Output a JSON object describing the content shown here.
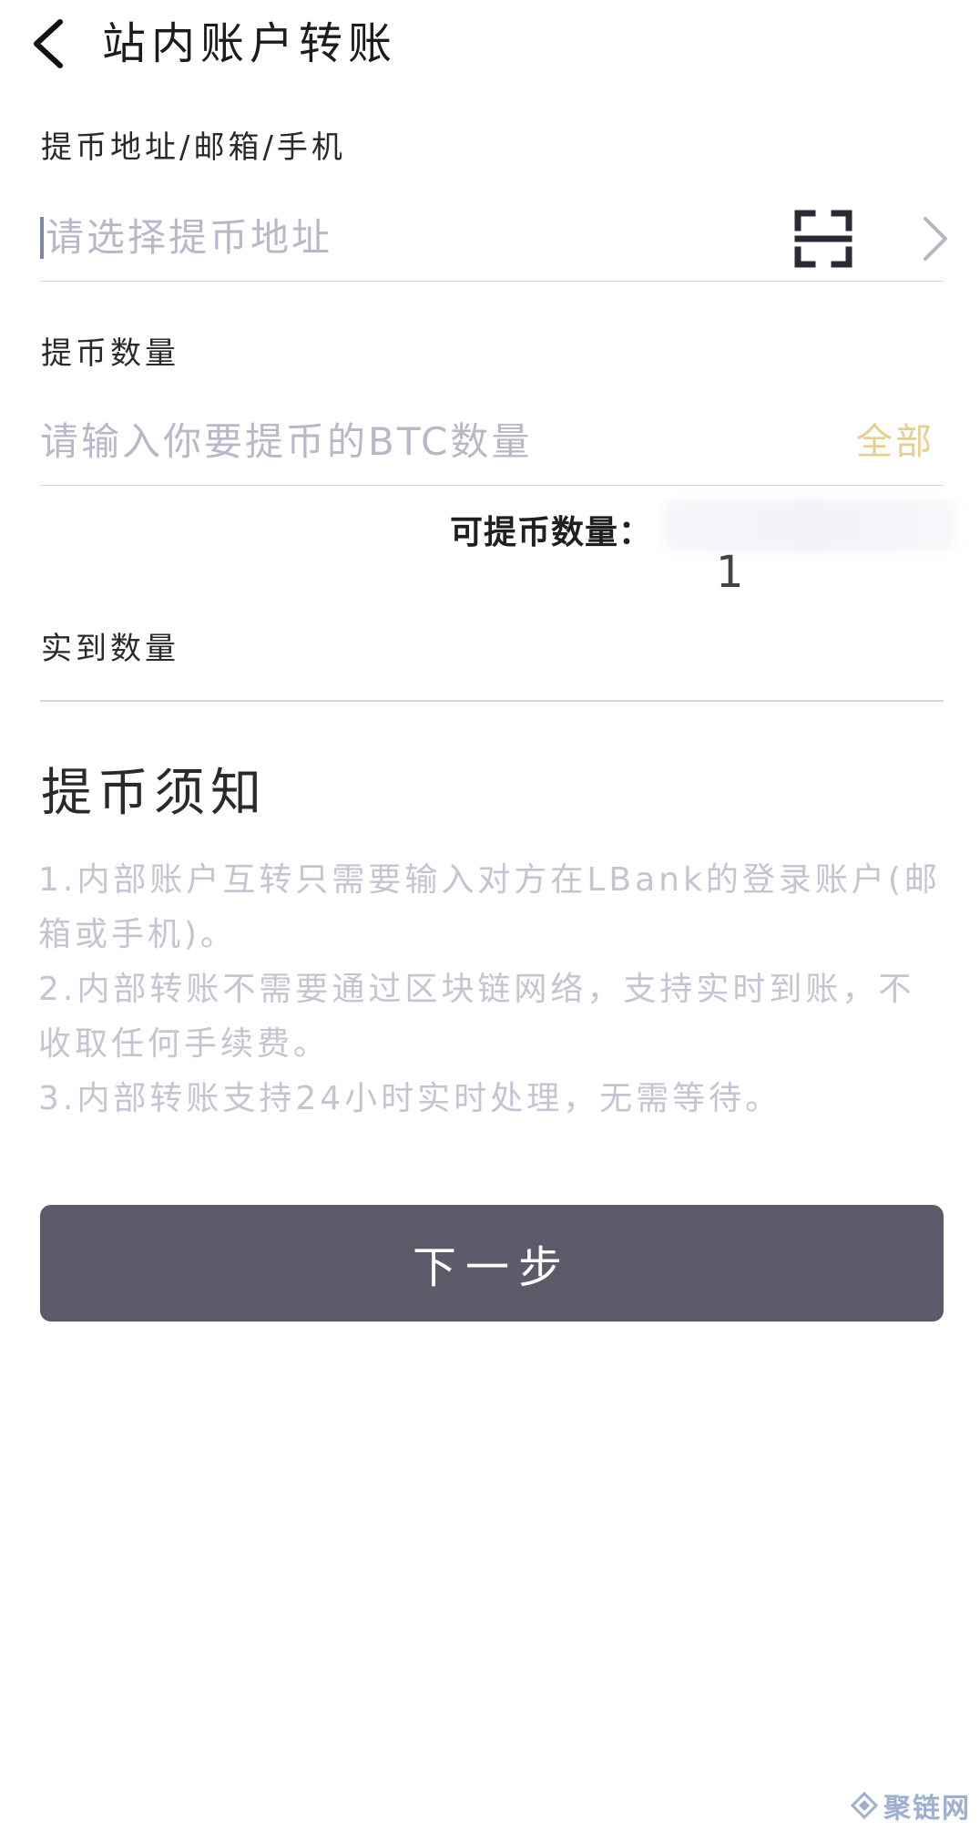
{
  "header": {
    "title": "站内账户转账"
  },
  "address": {
    "label": "提币地址/邮箱/手机",
    "placeholder": "请选择提币地址"
  },
  "amount": {
    "label": "提币数量",
    "placeholder": "请输入你要提币的BTC数量",
    "all_label": "全部",
    "available_label": "可提币数量：",
    "available_value": "1"
  },
  "received": {
    "label": "实到数量"
  },
  "notice": {
    "title": "提币须知",
    "items": [
      "1.内部账户互转只需要输入对方在LBank的登录账户(邮箱或手机)。",
      "2.内部转账不需要通过区块链网络，支持实时到账，不收取任何手续费。",
      "3.内部转账支持24小时实时处理，无需等待。"
    ]
  },
  "next_button": {
    "label": "下一步"
  },
  "watermark": {
    "text": "聚链网"
  },
  "colors": {
    "accent_gold": "#e6cf8f",
    "button_bg": "#5d5b6a",
    "placeholder": "#b7b9c9",
    "notice_text": "#c3c5d2"
  }
}
